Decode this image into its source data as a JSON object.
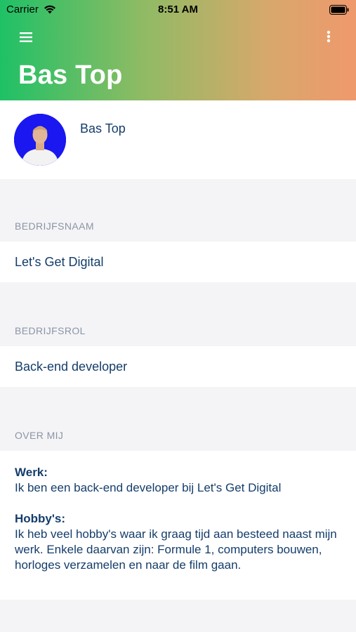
{
  "status_bar": {
    "carrier": "Carrier",
    "time": "8:51 AM",
    "icons": [
      "wifi-icon",
      "battery-icon"
    ]
  },
  "header": {
    "title": "Bas Top",
    "gradient_colors": [
      "#1fc166",
      "#f0996d"
    ],
    "left_icon": "hamburger-menu-icon",
    "right_icon": "more-vertical-icon"
  },
  "profile": {
    "name": "Bas Top",
    "avatar_background": "#1a17f0"
  },
  "sections": {
    "company": {
      "label": "BEDRIJFSNAAM",
      "value": "Let's Get Digital"
    },
    "role": {
      "label": "BEDRIJFSROL",
      "value": "Back-end developer"
    },
    "about": {
      "label": "OVER MIJ",
      "work_heading": "Werk:",
      "work_text": "Ik ben een back-end developer bij Let's Get Digital",
      "hobby_heading": "Hobby's:",
      "hobby_text": "Ik heb veel hobby's waar ik graag tijd aan besteed naast mijn werk. Enkele daarvan zijn: Formule 1, computers bouwen, horloges verzamelen en naar de film gaan."
    }
  },
  "colors": {
    "text_primary": "#143d6b",
    "section_label": "#8b94a6",
    "background": "#f4f4f6"
  }
}
